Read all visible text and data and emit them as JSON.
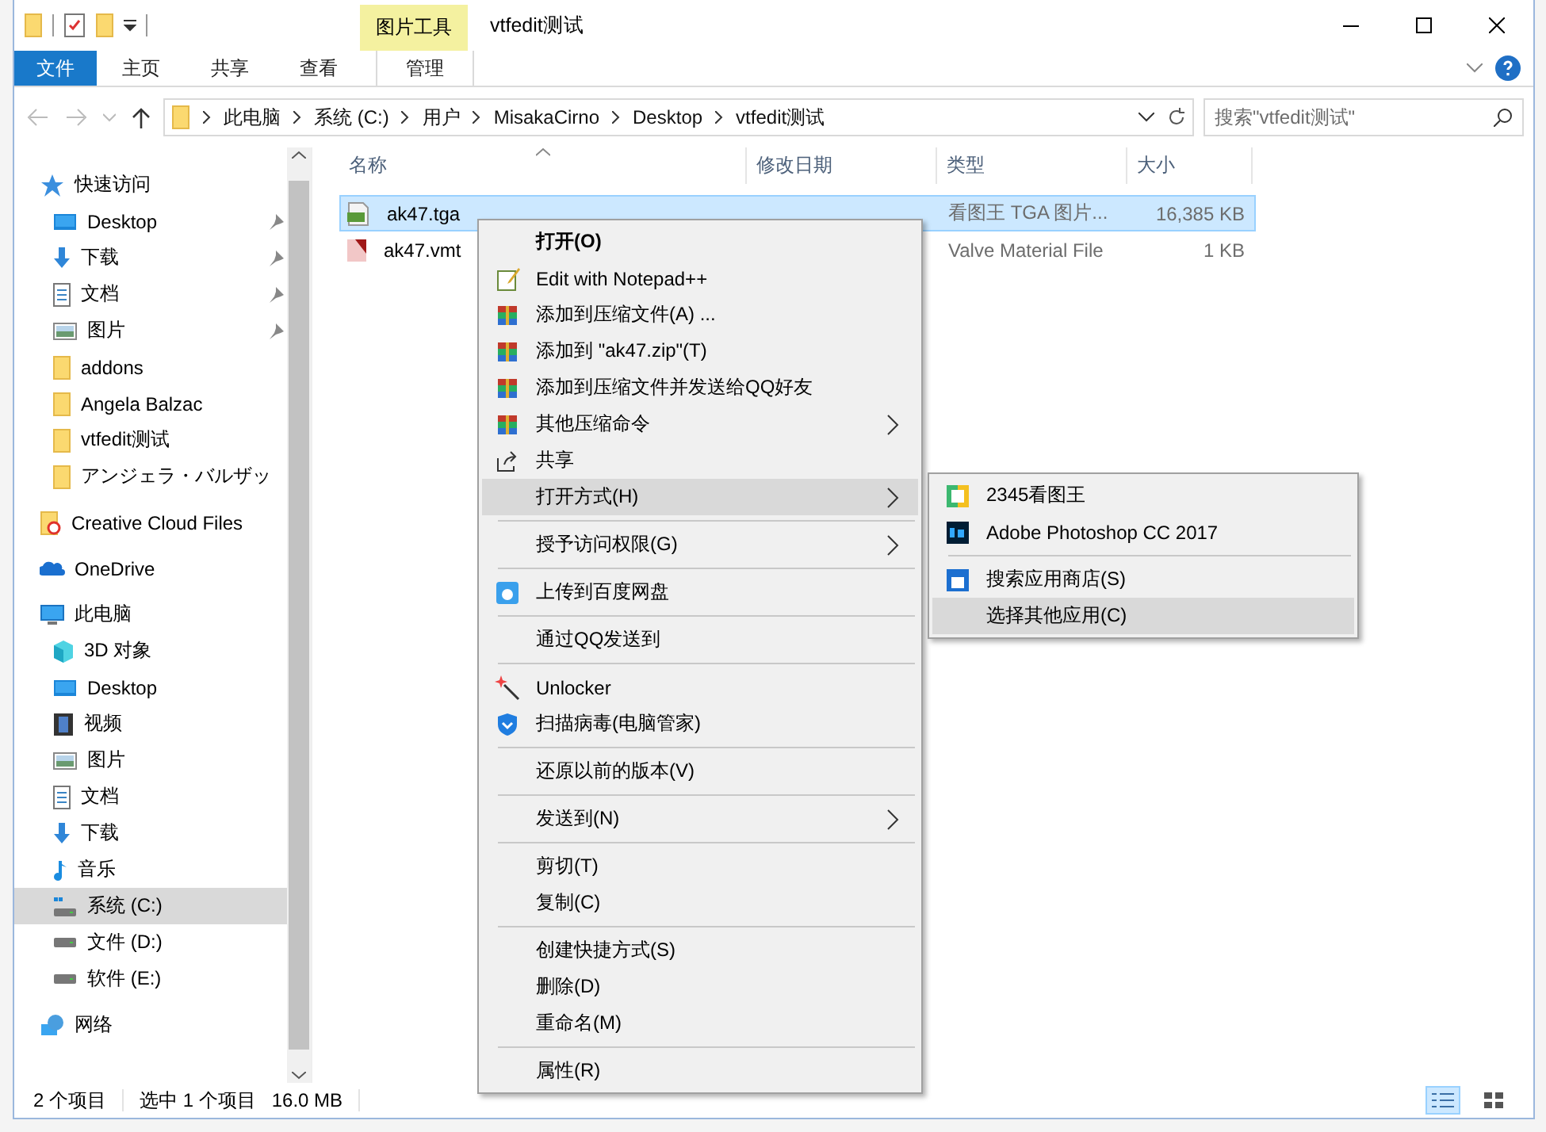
{
  "window": {
    "title": "vtfedit测试",
    "context_group": "图片工具"
  },
  "ribbon_tabs": [
    {
      "label": "文件",
      "kind": "file"
    },
    {
      "label": "主页",
      "kind": "plain"
    },
    {
      "label": "共享",
      "kind": "plain"
    },
    {
      "label": "查看",
      "kind": "plain"
    },
    {
      "label": "管理",
      "kind": "contextual"
    }
  ],
  "address": {
    "crumbs": [
      "此电脑",
      "系统 (C:)",
      "用户",
      "MisakaCirno",
      "Desktop",
      "vtfedit测试"
    ],
    "search_placeholder": "搜索\"vtfedit测试\""
  },
  "nav": [
    {
      "label": "快速访问",
      "kind": "star",
      "selected": false,
      "children": [
        {
          "label": "Desktop",
          "kind": "desktop",
          "pinned": true,
          "selected": false
        },
        {
          "label": "下载",
          "kind": "download",
          "pinned": true,
          "selected": false
        },
        {
          "label": "文档",
          "kind": "document",
          "pinned": true,
          "selected": false
        },
        {
          "label": "图片",
          "kind": "pictures",
          "pinned": true,
          "selected": false
        },
        {
          "label": "addons",
          "kind": "folder",
          "pinned": false,
          "selected": false
        },
        {
          "label": "Angela Balzac",
          "kind": "folder",
          "pinned": false,
          "selected": false
        },
        {
          "label": "vtfedit测试",
          "kind": "folder",
          "pinned": false,
          "selected": false
        },
        {
          "label": "アンジェラ・バルザッ",
          "kind": "folder",
          "pinned": false,
          "selected": false
        }
      ]
    },
    {
      "label": "Creative Cloud Files",
      "kind": "cc",
      "selected": false
    },
    {
      "label": "OneDrive",
      "kind": "onedrive",
      "selected": false
    },
    {
      "label": "此电脑",
      "kind": "pc",
      "selected": false,
      "children": [
        {
          "label": "3D 对象",
          "kind": "cube",
          "selected": false
        },
        {
          "label": "Desktop",
          "kind": "desktop",
          "selected": false
        },
        {
          "label": "视频",
          "kind": "video",
          "selected": false
        },
        {
          "label": "图片",
          "kind": "pictures",
          "selected": false
        },
        {
          "label": "文档",
          "kind": "document",
          "selected": false
        },
        {
          "label": "下载",
          "kind": "download",
          "selected": false
        },
        {
          "label": "音乐",
          "kind": "music",
          "selected": false
        },
        {
          "label": "系统 (C:)",
          "kind": "sysdrive",
          "selected": true
        },
        {
          "label": "文件 (D:)",
          "kind": "drive",
          "selected": false
        },
        {
          "label": "软件 (E:)",
          "kind": "drive",
          "selected": false
        }
      ]
    },
    {
      "label": "网络",
      "kind": "network",
      "selected": false
    }
  ],
  "columns": [
    {
      "label": "名称",
      "sorted": true
    },
    {
      "label": "修改日期",
      "sorted": false
    },
    {
      "label": "类型",
      "sorted": false
    },
    {
      "label": "大小",
      "sorted": false
    }
  ],
  "files": [
    {
      "name": "ak47.tga",
      "kind": "pic",
      "type": "看图王 TGA 图片...",
      "size": "16,385 KB",
      "selected": true
    },
    {
      "name": "ak47.vmt",
      "kind": "vmt",
      "type": "Valve Material File",
      "size": "1 KB",
      "selected": false
    }
  ],
  "context_menu": {
    "items": [
      {
        "kind": "plain",
        "label": "打开(O)",
        "bold": true,
        "submenu": false,
        "selected": false
      },
      {
        "kind": "notepad",
        "label": "Edit with Notepad++",
        "bold": false,
        "submenu": false,
        "selected": false
      },
      {
        "kind": "winrar",
        "label": "添加到压缩文件(A) ...",
        "bold": false,
        "submenu": false,
        "selected": false
      },
      {
        "kind": "winrar",
        "label": "添加到 \"ak47.zip\"(T)",
        "bold": false,
        "submenu": false,
        "selected": false
      },
      {
        "kind": "winrar",
        "label": "添加到压缩文件并发送给QQ好友",
        "bold": false,
        "submenu": false,
        "selected": false
      },
      {
        "kind": "winrar",
        "label": "其他压缩命令",
        "bold": false,
        "submenu": true,
        "selected": false
      },
      {
        "kind": "share",
        "label": "共享",
        "bold": false,
        "submenu": false,
        "selected": false
      },
      {
        "kind": "plain",
        "label": "打开方式(H)",
        "bold": false,
        "submenu": true,
        "selected": true
      },
      {
        "kind": "separator"
      },
      {
        "kind": "plain",
        "label": "授予访问权限(G)",
        "bold": false,
        "submenu": true,
        "selected": false
      },
      {
        "kind": "separator"
      },
      {
        "kind": "baidu",
        "label": "上传到百度网盘",
        "bold": false,
        "submenu": false,
        "selected": false
      },
      {
        "kind": "separator"
      },
      {
        "kind": "plain",
        "label": "通过QQ发送到",
        "bold": false,
        "submenu": false,
        "selected": false
      },
      {
        "kind": "separator"
      },
      {
        "kind": "unlocker",
        "label": "Unlocker",
        "bold": false,
        "submenu": false,
        "selected": false
      },
      {
        "kind": "shield",
        "label": "扫描病毒(电脑管家)",
        "bold": false,
        "submenu": false,
        "selected": false
      },
      {
        "kind": "separator"
      },
      {
        "kind": "plain",
        "label": "还原以前的版本(V)",
        "bold": false,
        "submenu": false,
        "selected": false
      },
      {
        "kind": "separator"
      },
      {
        "kind": "plain",
        "label": "发送到(N)",
        "bold": false,
        "submenu": true,
        "selected": false
      },
      {
        "kind": "separator"
      },
      {
        "kind": "plain",
        "label": "剪切(T)",
        "bold": false,
        "submenu": false,
        "selected": false
      },
      {
        "kind": "plain",
        "label": "复制(C)",
        "bold": false,
        "submenu": false,
        "selected": false
      },
      {
        "kind": "separator"
      },
      {
        "kind": "plain",
        "label": "创建快捷方式(S)",
        "bold": false,
        "submenu": false,
        "selected": false
      },
      {
        "kind": "plain",
        "label": "删除(D)",
        "bold": false,
        "submenu": false,
        "selected": false
      },
      {
        "kind": "plain",
        "label": "重命名(M)",
        "bold": false,
        "submenu": false,
        "selected": false
      },
      {
        "kind": "separator"
      },
      {
        "kind": "plain",
        "label": "属性(R)",
        "bold": false,
        "submenu": false,
        "selected": false
      }
    ]
  },
  "open_with_menu": {
    "items": [
      {
        "kind": "viewer",
        "label": "2345看图王",
        "selected": false
      },
      {
        "kind": "photoshop",
        "label": "Adobe Photoshop CC 2017",
        "selected": false
      },
      {
        "kind": "separator"
      },
      {
        "kind": "store",
        "label": "搜索应用商店(S)",
        "selected": false
      },
      {
        "kind": "plain",
        "label": "选择其他应用(C)",
        "selected": true
      }
    ]
  },
  "status_bar": {
    "items": [
      "2 个项目",
      "选中 1 个项目",
      "16.0 MB"
    ],
    "views": [
      {
        "kind": "details",
        "selected": true
      },
      {
        "kind": "tiles",
        "selected": false
      }
    ]
  }
}
